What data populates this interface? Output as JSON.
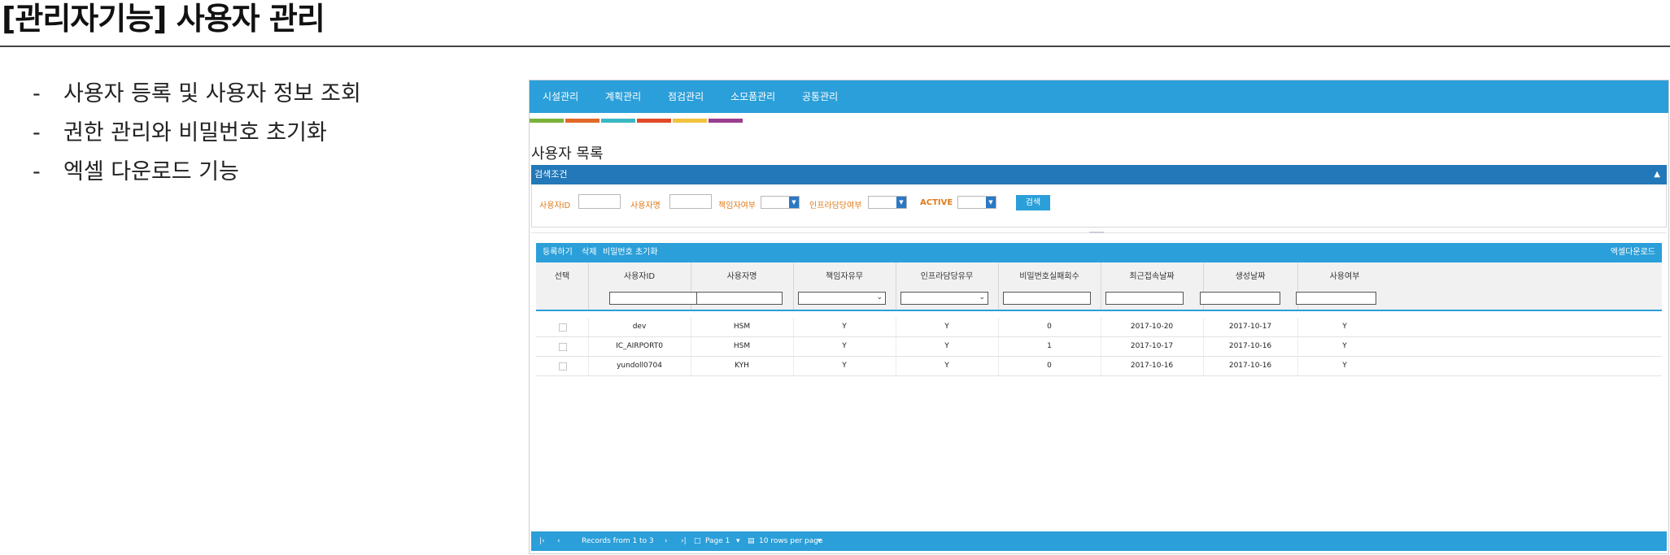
{
  "slide": {
    "title": "[관리자기능] 사용자 관리",
    "bullets": [
      "사용자 등록 및 사용자 정보 조회",
      "권한 관리와 비밀번호 초기화",
      "엑셀 다운로드 기능"
    ],
    "bullet_marker": "-"
  },
  "app": {
    "menu": [
      "시설관리",
      "계획관리",
      "점검관리",
      "소모품관리",
      "공통관리"
    ],
    "accent_colors": [
      "#7bb33a",
      "#e2692a",
      "#3ab8c4",
      "#e04a27",
      "#f2c23c",
      "#9a3e8f"
    ],
    "nav_color": "#2b9fd9",
    "page_heading": "사용자 목록",
    "search": {
      "header": "검색조건",
      "toggle_icon": "chevron-up-icon",
      "labels": {
        "user_id": "사용자ID",
        "user_name": "사용자명",
        "manager": "책임자여부",
        "infra": "인프라담당여부",
        "active": "ACTIVE"
      },
      "button": "검색"
    },
    "toolbar": {
      "register": "등록하기",
      "delete": "삭제",
      "reset_password": "비밀번호 초기화",
      "excel": "엑셀다운로드"
    },
    "table": {
      "columns": [
        "선택",
        "사용자ID",
        "사용자명",
        "책임자유무",
        "인프라담당유무",
        "비밀번호실패회수",
        "최근접속날짜",
        "생성날짜",
        "사용여부"
      ],
      "rows": [
        {
          "id": "dev",
          "name": "HSM",
          "manager": "Y",
          "infra": "Y",
          "fail": "0",
          "last": "2017-10-20",
          "created": "2017-10-17",
          "use": "Y"
        },
        {
          "id": "IC_AIRPORT0",
          "name": "HSM",
          "manager": "Y",
          "infra": "Y",
          "fail": "1",
          "last": "2017-10-17",
          "created": "2017-10-16",
          "use": "Y"
        },
        {
          "id": "yundoll0704",
          "name": "KYH",
          "manager": "Y",
          "infra": "Y",
          "fail": "0",
          "last": "2017-10-16",
          "created": "2017-10-16",
          "use": "Y"
        }
      ]
    },
    "pager": {
      "records": "Records from 1 to 3",
      "page": "Page 1",
      "rows_per_page": "10 rows per page"
    }
  }
}
